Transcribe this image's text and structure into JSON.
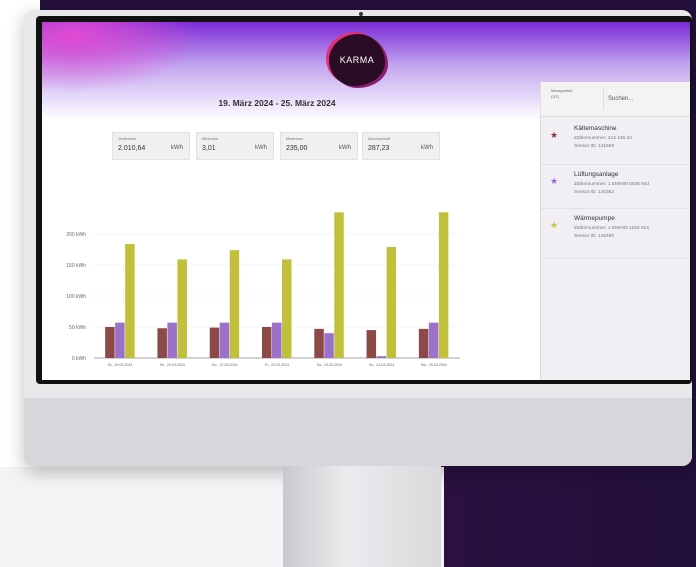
{
  "app": {
    "logo": "KARMA"
  },
  "header": {
    "date_range": "19. März 2024 - 25. März 2024"
  },
  "stats": [
    {
      "label": "Verbrauch",
      "value": "2.010,64",
      "unit": "kWh"
    },
    {
      "label": "Minimum",
      "value": "3,01",
      "unit": "kWh"
    },
    {
      "label": "Maximum",
      "value": "235,00",
      "unit": "kWh"
    },
    {
      "label": "Durchschnitt",
      "value": "287,23",
      "unit": "kWh"
    }
  ],
  "panel": {
    "measuring_points_label": "Messpunkte",
    "measuring_points_count": "(3/7)",
    "search_placeholder": "Suchen...",
    "items": [
      {
        "name": "Kältemaschine",
        "meter": "Zählernummer: 212 246 34",
        "sensor": "Sensor ID: 141559",
        "color": "#8a3a3a"
      },
      {
        "name": "Lüftungsanlage",
        "meter": "Zählernummer: 1 EMH00 0836 943",
        "sensor": "Sensor ID: 140382",
        "color": "#9a6bd0"
      },
      {
        "name": "Wärmepumpe",
        "meter": "Zählernummer: 1 EMH00 1168 913",
        "sensor": "Sensor ID: 148490",
        "color": "#c7c53a"
      }
    ]
  },
  "chart_data": {
    "type": "bar",
    "categories": [
      "Di., 19.03.2024",
      "Mi., 20.03.2024",
      "Do., 21.03.2024",
      "Fr., 22.03.2024",
      "Sa., 23.03.2024",
      "So., 24.03.2024",
      "Mo., 25.03.2024"
    ],
    "series": [
      {
        "name": "Kältemaschine",
        "color": "#8b4a47",
        "values": [
          50,
          48,
          49,
          50,
          47,
          45,
          47
        ]
      },
      {
        "name": "Lüftungsanlage",
        "color": "#9b72c8",
        "values": [
          57,
          57,
          57,
          57,
          40,
          3,
          57
        ]
      },
      {
        "name": "Wärmepumpe",
        "color": "#c1c03c",
        "values": [
          184,
          159,
          174,
          159,
          235,
          179,
          235
        ]
      }
    ],
    "yticks": [
      "0 kWh",
      "50 kWh",
      "100 kWh",
      "150 kWh",
      "200 kWh"
    ],
    "ylim": [
      0,
      250
    ],
    "grid": true
  }
}
